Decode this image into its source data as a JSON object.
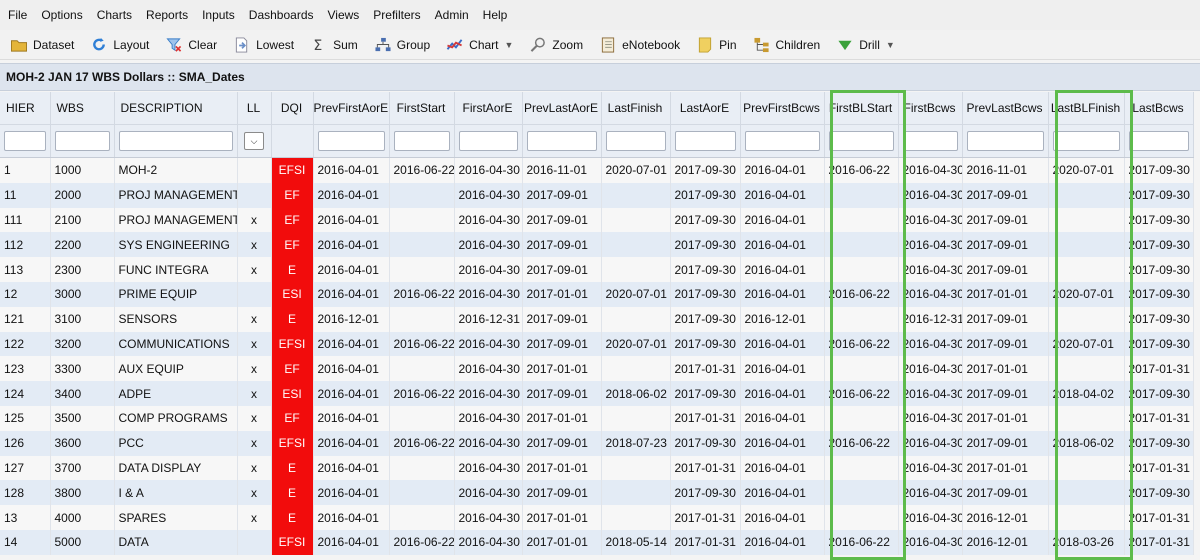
{
  "menu": [
    "File",
    "Options",
    "Charts",
    "Reports",
    "Inputs",
    "Dashboards",
    "Views",
    "Prefilters",
    "Admin",
    "Help"
  ],
  "toolbar": [
    {
      "label": "Dataset",
      "icon": "folder-icon",
      "color": "#e4b53a"
    },
    {
      "label": "Layout",
      "icon": "refresh-icon",
      "color": "#2f7fd6"
    },
    {
      "label": "Clear",
      "icon": "clear-filter-icon",
      "color": "#3a7ec8"
    },
    {
      "label": "Lowest",
      "icon": "document-arrow-icon",
      "color": "#6a8fc8"
    },
    {
      "label": "Sum",
      "icon": "sigma-icon",
      "color": "#444444"
    },
    {
      "label": "Group",
      "icon": "hierarchy-icon",
      "color": "#4a6fb0"
    },
    {
      "label": "Chart",
      "icon": "line-chart-icon",
      "color": "#d43a3a",
      "dropdown": true
    },
    {
      "label": "Zoom",
      "icon": "magnifier-icon",
      "color": "#777777"
    },
    {
      "label": "eNotebook",
      "icon": "notebook-icon",
      "color": "#8b6b3a"
    },
    {
      "label": "Pin",
      "icon": "note-pin-icon",
      "color": "#f0d060"
    },
    {
      "label": "Children",
      "icon": "children-tree-icon",
      "color": "#c89a30"
    },
    {
      "label": "Drill",
      "icon": "drill-down-icon",
      "color": "#3aa23a",
      "dropdown": true
    }
  ],
  "title": "MOH-2 JAN 17 WBS Dollars :: SMA_Dates",
  "columns": [
    "HIER",
    "WBS",
    "DESCRIPTION",
    "LL",
    "DQI",
    "PrevFirstAorE",
    "FirstStart",
    "FirstAorE",
    "PrevLastAorE",
    "LastFinish",
    "LastAorE",
    "PrevFirstBcws",
    "FirstBLStart",
    "FirstBcws",
    "PrevLastBcws",
    "LastBLFinish",
    "LastBcws"
  ],
  "rows": [
    [
      "1",
      "1000",
      "MOH-2",
      "",
      "EFSI",
      "2016-04-01",
      "2016-06-22",
      "2016-04-30",
      "2016-11-01",
      "2020-07-01",
      "2017-09-30",
      "2016-04-01",
      "2016-06-22",
      "2016-04-30",
      "2016-11-01",
      "2020-07-01",
      "2017-09-30"
    ],
    [
      "11",
      "2000",
      "PROJ MANAGEMENT",
      "",
      "EF",
      "2016-04-01",
      "",
      "2016-04-30",
      "2017-09-01",
      "",
      "2017-09-30",
      "2016-04-01",
      "",
      "2016-04-30",
      "2017-09-01",
      "",
      "2017-09-30"
    ],
    [
      "111",
      "2100",
      "PROJ MANAGEMENT",
      "x",
      "EF",
      "2016-04-01",
      "",
      "2016-04-30",
      "2017-09-01",
      "",
      "2017-09-30",
      "2016-04-01",
      "",
      "2016-04-30",
      "2017-09-01",
      "",
      "2017-09-30"
    ],
    [
      "112",
      "2200",
      "SYS ENGINEERING",
      "x",
      "EF",
      "2016-04-01",
      "",
      "2016-04-30",
      "2017-09-01",
      "",
      "2017-09-30",
      "2016-04-01",
      "",
      "2016-04-30",
      "2017-09-01",
      "",
      "2017-09-30"
    ],
    [
      "113",
      "2300",
      "FUNC INTEGRA",
      "x",
      "E",
      "2016-04-01",
      "",
      "2016-04-30",
      "2017-09-01",
      "",
      "2017-09-30",
      "2016-04-01",
      "",
      "2016-04-30",
      "2017-09-01",
      "",
      "2017-09-30"
    ],
    [
      "12",
      "3000",
      "PRIME EQUIP",
      "",
      "ESI",
      "2016-04-01",
      "2016-06-22",
      "2016-04-30",
      "2017-01-01",
      "2020-07-01",
      "2017-09-30",
      "2016-04-01",
      "2016-06-22",
      "2016-04-30",
      "2017-01-01",
      "2020-07-01",
      "2017-09-30"
    ],
    [
      "121",
      "3100",
      "SENSORS",
      "x",
      "E",
      "2016-12-01",
      "",
      "2016-12-31",
      "2017-09-01",
      "",
      "2017-09-30",
      "2016-12-01",
      "",
      "2016-12-31",
      "2017-09-01",
      "",
      "2017-09-30"
    ],
    [
      "122",
      "3200",
      "COMMUNICATIONS",
      "x",
      "EFSI",
      "2016-04-01",
      "2016-06-22",
      "2016-04-30",
      "2017-09-01",
      "2020-07-01",
      "2017-09-30",
      "2016-04-01",
      "2016-06-22",
      "2016-04-30",
      "2017-09-01",
      "2020-07-01",
      "2017-09-30"
    ],
    [
      "123",
      "3300",
      "AUX EQUIP",
      "x",
      "EF",
      "2016-04-01",
      "",
      "2016-04-30",
      "2017-01-01",
      "",
      "2017-01-31",
      "2016-04-01",
      "",
      "2016-04-30",
      "2017-01-01",
      "",
      "2017-01-31"
    ],
    [
      "124",
      "3400",
      "ADPE",
      "x",
      "ESI",
      "2016-04-01",
      "2016-06-22",
      "2016-04-30",
      "2017-09-01",
      "2018-06-02",
      "2017-09-30",
      "2016-04-01",
      "2016-06-22",
      "2016-04-30",
      "2017-09-01",
      "2018-04-02",
      "2017-09-30"
    ],
    [
      "125",
      "3500",
      "COMP PROGRAMS",
      "x",
      "EF",
      "2016-04-01",
      "",
      "2016-04-30",
      "2017-01-01",
      "",
      "2017-01-31",
      "2016-04-01",
      "",
      "2016-04-30",
      "2017-01-01",
      "",
      "2017-01-31"
    ],
    [
      "126",
      "3600",
      "PCC",
      "x",
      "EFSI",
      "2016-04-01",
      "2016-06-22",
      "2016-04-30",
      "2017-09-01",
      "2018-07-23",
      "2017-09-30",
      "2016-04-01",
      "2016-06-22",
      "2016-04-30",
      "2017-09-01",
      "2018-06-02",
      "2017-09-30"
    ],
    [
      "127",
      "3700",
      "DATA DISPLAY",
      "x",
      "E",
      "2016-04-01",
      "",
      "2016-04-30",
      "2017-01-01",
      "",
      "2017-01-31",
      "2016-04-01",
      "",
      "2016-04-30",
      "2017-01-01",
      "",
      "2017-01-31"
    ],
    [
      "128",
      "3800",
      "I & A",
      "x",
      "E",
      "2016-04-01",
      "",
      "2016-04-30",
      "2017-09-01",
      "",
      "2017-09-30",
      "2016-04-01",
      "",
      "2016-04-30",
      "2017-09-01",
      "",
      "2017-09-30"
    ],
    [
      "13",
      "4000",
      "SPARES",
      "x",
      "E",
      "2016-04-01",
      "",
      "2016-04-30",
      "2017-01-01",
      "",
      "2017-01-31",
      "2016-04-01",
      "",
      "2016-04-30",
      "2016-12-01",
      "",
      "2017-01-31"
    ],
    [
      "14",
      "5000",
      "DATA",
      "",
      "EFSI",
      "2016-04-01",
      "2016-06-22",
      "2016-04-30",
      "2017-01-01",
      "2018-05-14",
      "2017-01-31",
      "2016-04-01",
      "2016-06-22",
      "2016-04-30",
      "2016-12-01",
      "2018-03-26",
      "2017-01-31"
    ]
  ],
  "dqi_color": "#f20c0c",
  "highlight_color": "#5dbb4b"
}
